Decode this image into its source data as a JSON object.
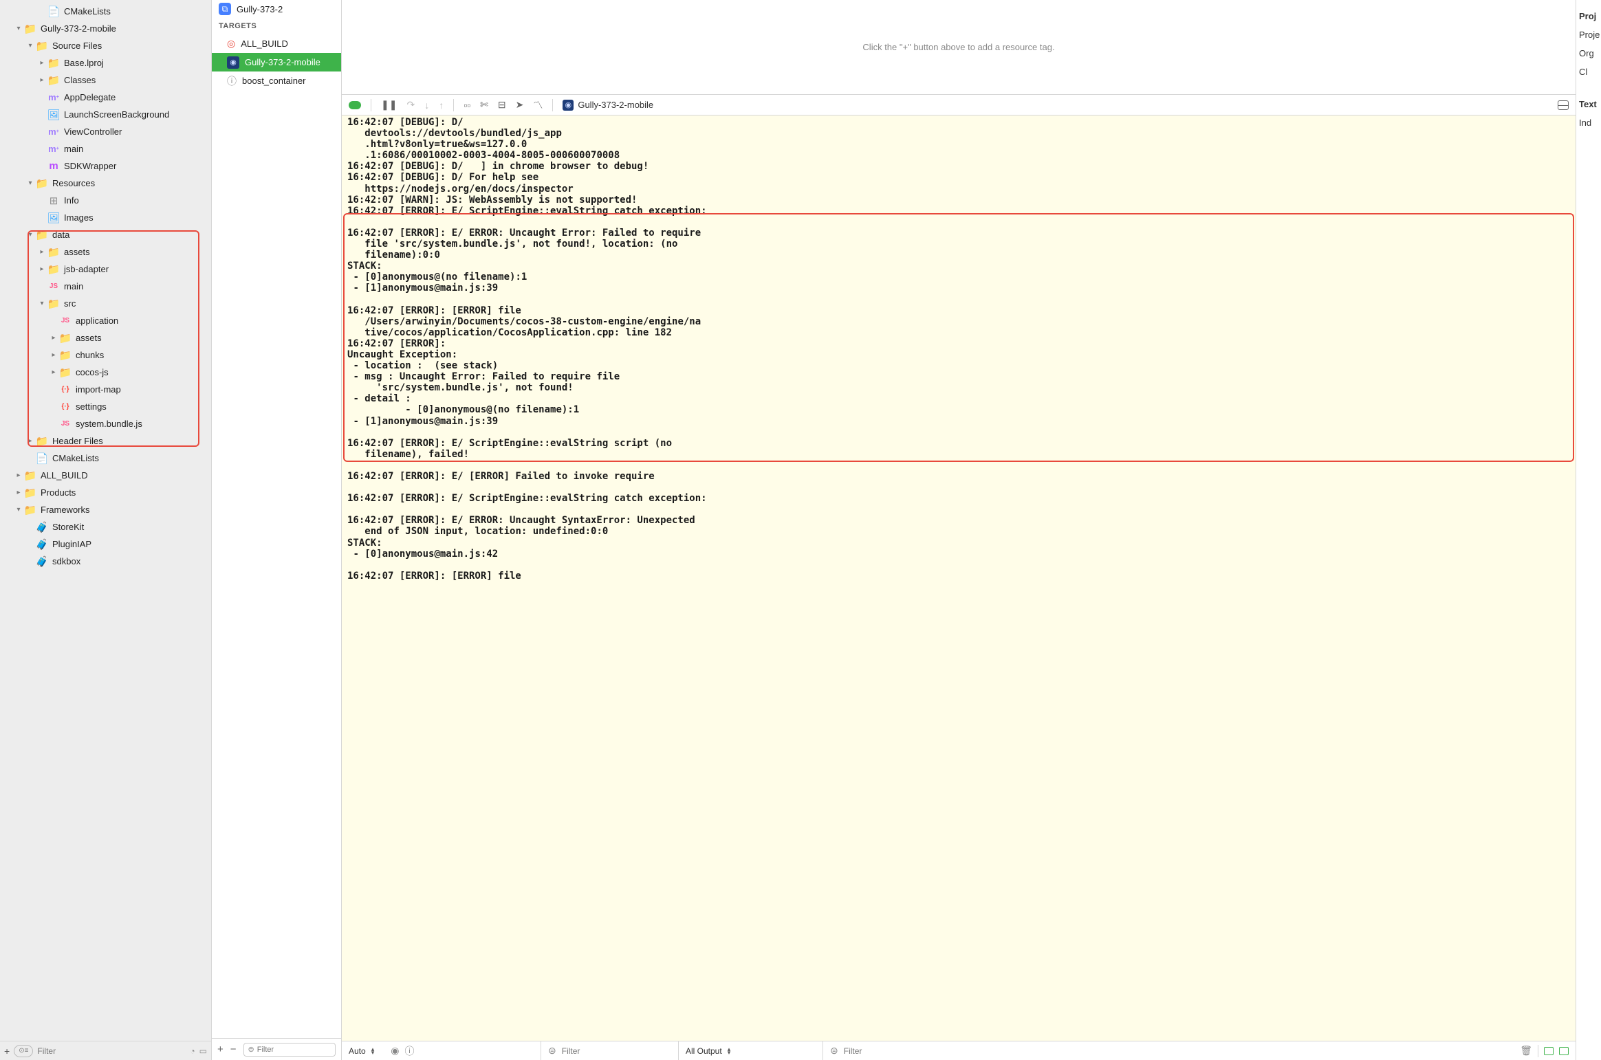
{
  "navigator": {
    "filter_placeholder": "Filter",
    "tree": [
      {
        "icon": "file",
        "label": "CMakeLists",
        "indent": 3,
        "disclosure": ""
      },
      {
        "icon": "folder",
        "label": "Gully-373-2-mobile",
        "indent": 1,
        "disclosure": "down"
      },
      {
        "icon": "folder",
        "label": "Source Files",
        "indent": 2,
        "disclosure": "down"
      },
      {
        "icon": "folder",
        "label": "Base.lproj",
        "indent": 3,
        "disclosure": "right"
      },
      {
        "icon": "folder",
        "label": "Classes",
        "indent": 3,
        "disclosure": "right"
      },
      {
        "icon": "m",
        "label": "AppDelegate",
        "indent": 3,
        "disclosure": ""
      },
      {
        "icon": "img",
        "label": "LaunchScreenBackground",
        "indent": 3,
        "disclosure": ""
      },
      {
        "icon": "m",
        "label": "ViewController",
        "indent": 3,
        "disclosure": ""
      },
      {
        "icon": "m",
        "label": "main",
        "indent": 3,
        "disclosure": ""
      },
      {
        "icon": "mpurple",
        "label": "SDKWrapper",
        "indent": 3,
        "disclosure": ""
      },
      {
        "icon": "folder",
        "label": "Resources",
        "indent": 2,
        "disclosure": "down"
      },
      {
        "icon": "grid",
        "label": "Info",
        "indent": 3,
        "disclosure": ""
      },
      {
        "icon": "img",
        "label": "Images",
        "indent": 3,
        "disclosure": ""
      },
      {
        "icon": "folder-blue",
        "label": "data",
        "indent": 2,
        "disclosure": "down",
        "hl": true
      },
      {
        "icon": "folder-blue",
        "label": "assets",
        "indent": 3,
        "disclosure": "right",
        "hl": true
      },
      {
        "icon": "folder-blue",
        "label": "jsb-adapter",
        "indent": 3,
        "disclosure": "right",
        "hl": true
      },
      {
        "icon": "js",
        "label": "main",
        "indent": 3,
        "disclosure": "",
        "hl": true
      },
      {
        "icon": "folder-blue",
        "label": "src",
        "indent": 3,
        "disclosure": "down",
        "hl": true
      },
      {
        "icon": "js",
        "label": "application",
        "indent": 4,
        "disclosure": "",
        "hl": true
      },
      {
        "icon": "folder-blue",
        "label": "assets",
        "indent": 4,
        "disclosure": "right",
        "hl": true
      },
      {
        "icon": "folder-blue",
        "label": "chunks",
        "indent": 4,
        "disclosure": "right",
        "hl": true
      },
      {
        "icon": "folder-blue",
        "label": "cocos-js",
        "indent": 4,
        "disclosure": "right",
        "hl": true
      },
      {
        "icon": "json",
        "label": "import-map",
        "indent": 4,
        "disclosure": "",
        "hl": true
      },
      {
        "icon": "json",
        "label": "settings",
        "indent": 4,
        "disclosure": "",
        "hl": true
      },
      {
        "icon": "js",
        "label": "system.bundle.js",
        "indent": 4,
        "disclosure": "",
        "hl": true
      },
      {
        "icon": "folder",
        "label": "Header Files",
        "indent": 2,
        "disclosure": "right"
      },
      {
        "icon": "file",
        "label": "CMakeLists",
        "indent": 2,
        "disclosure": ""
      },
      {
        "icon": "folder",
        "label": "ALL_BUILD",
        "indent": 1,
        "disclosure": "right"
      },
      {
        "icon": "folder",
        "label": "Products",
        "indent": 1,
        "disclosure": "right"
      },
      {
        "icon": "folder",
        "label": "Frameworks",
        "indent": 1,
        "disclosure": "down"
      },
      {
        "icon": "fw",
        "label": "StoreKit",
        "indent": 2,
        "disclosure": ""
      },
      {
        "icon": "fw",
        "label": "PluginIAP",
        "indent": 2,
        "disclosure": ""
      },
      {
        "icon": "fw",
        "label": "sdkbox",
        "indent": 2,
        "disclosure": ""
      }
    ]
  },
  "targets_col": {
    "project": "Gully-373-2",
    "header": "TARGETS",
    "items": [
      {
        "icon": "bullseye",
        "label": "ALL_BUILD",
        "selected": false
      },
      {
        "icon": "drop",
        "label": "Gully-373-2-mobile",
        "selected": true
      },
      {
        "icon": "greek",
        "label": "boost_container",
        "selected": false
      }
    ],
    "filter_placeholder": "Filter"
  },
  "resource_hint": "Click the \"+\" button above to add a resource tag.",
  "breadcrumb": "Gully-373-2-mobile",
  "console_lines": [
    "16:42:07 [DEBUG]: D/",
    "   devtools://devtools/bundled/js_app",
    "   .html?v8only=true&ws=127.0.0",
    "   .1:6086/00010002-0003-4004-8005-000600070008",
    "16:42:07 [DEBUG]: D/   ] in chrome browser to debug!",
    "16:42:07 [DEBUG]: D/ For help see",
    "   https://nodejs.org/en/docs/inspector",
    "16:42:07 [WARN]: JS: WebAssembly is not supported!",
    "16:42:07 [ERROR]: E/ ScriptEngine::evalString catch exception:",
    "",
    "16:42:07 [ERROR]: E/ ERROR: Uncaught Error: Failed to require",
    "   file 'src/system.bundle.js', not found!, location: (no",
    "   filename):0:0",
    "STACK:",
    " - [0]anonymous@(no filename):1",
    " - [1]anonymous@main.js:39",
    "",
    "16:42:07 [ERROR]: [ERROR] file",
    "   /Users/arwinyin/Documents/cocos-38-custom-engine/engine/na",
    "   tive/cocos/application/CocosApplication.cpp: line 182",
    "16:42:07 [ERROR]:",
    "Uncaught Exception:",
    " - location :  (see stack)",
    " - msg : Uncaught Error: Failed to require file",
    "     'src/system.bundle.js', not found!",
    " - detail :",
    "          - [0]anonymous@(no filename):1",
    " - [1]anonymous@main.js:39",
    "",
    "16:42:07 [ERROR]: E/ ScriptEngine::evalString script (no",
    "   filename), failed!",
    "",
    "16:42:07 [ERROR]: E/ [ERROR] Failed to invoke require",
    "",
    "16:42:07 [ERROR]: E/ ScriptEngine::evalString catch exception:",
    "",
    "16:42:07 [ERROR]: E/ ERROR: Uncaught SyntaxError: Unexpected",
    "   end of JSON input, location: undefined:0:0",
    "STACK:",
    " - [0]anonymous@main.js:42",
    "",
    "16:42:07 [ERROR]: [ERROR] file"
  ],
  "console_bottom": {
    "left_sel": "Auto",
    "mid_sel": "All Output",
    "filter_placeholder": "Filter"
  },
  "inspector": {
    "items": [
      "Proj",
      "Proje",
      "Org",
      "Cl",
      "",
      "Text",
      "Ind"
    ]
  }
}
